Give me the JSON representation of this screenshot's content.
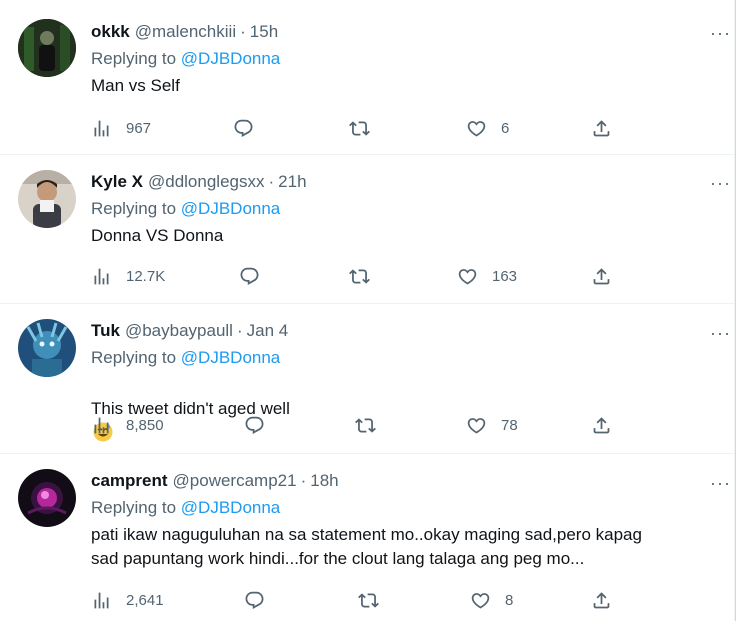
{
  "colors": {
    "accent": "#1d9bf0",
    "secondary_text": "#536471",
    "primary_text": "#0f1419",
    "divider": "#eff3f4"
  },
  "tweets": [
    {
      "name": "okkk",
      "handle": "@malenchkiii",
      "dot": "·",
      "time": "15h",
      "reply_prefix": "Replying to",
      "reply_mention": "@DJBDonna",
      "text": "Man vs Self",
      "views": "967",
      "replies": "",
      "retweets": "",
      "likes": "6",
      "more": "···"
    },
    {
      "name": "Kyle X",
      "handle": "@ddlonglegsxx",
      "dot": "·",
      "time": "21h",
      "reply_prefix": "Replying to",
      "reply_mention": "@DJBDonna",
      "text": "Donna VS Donna",
      "views": "12.7K",
      "replies": "",
      "retweets": "",
      "likes": "163",
      "more": "···"
    },
    {
      "name": "Tuk",
      "handle": "@baybaypaull",
      "dot": "·",
      "time": "Jan 4",
      "reply_prefix": "Replying to",
      "reply_mention": "@DJBDonna",
      "text": "This tweet didn't aged well",
      "emoji": "sweat-smile-emoji",
      "views": "8,850",
      "replies": "",
      "retweets": "",
      "likes": "78",
      "more": "···"
    },
    {
      "name": "camprent",
      "handle": "@powercamp21",
      "dot": "·",
      "time": "18h",
      "reply_prefix": "Replying to",
      "reply_mention": "@DJBDonna",
      "text": "pati ikaw naguguluhan na sa statement mo..okay maging sad,pero kapag\nsad papuntang work hindi...for the clout lang talaga ang peg mo...",
      "views": "2,641",
      "replies": "",
      "retweets": "",
      "likes": "8",
      "more": "···"
    }
  ]
}
